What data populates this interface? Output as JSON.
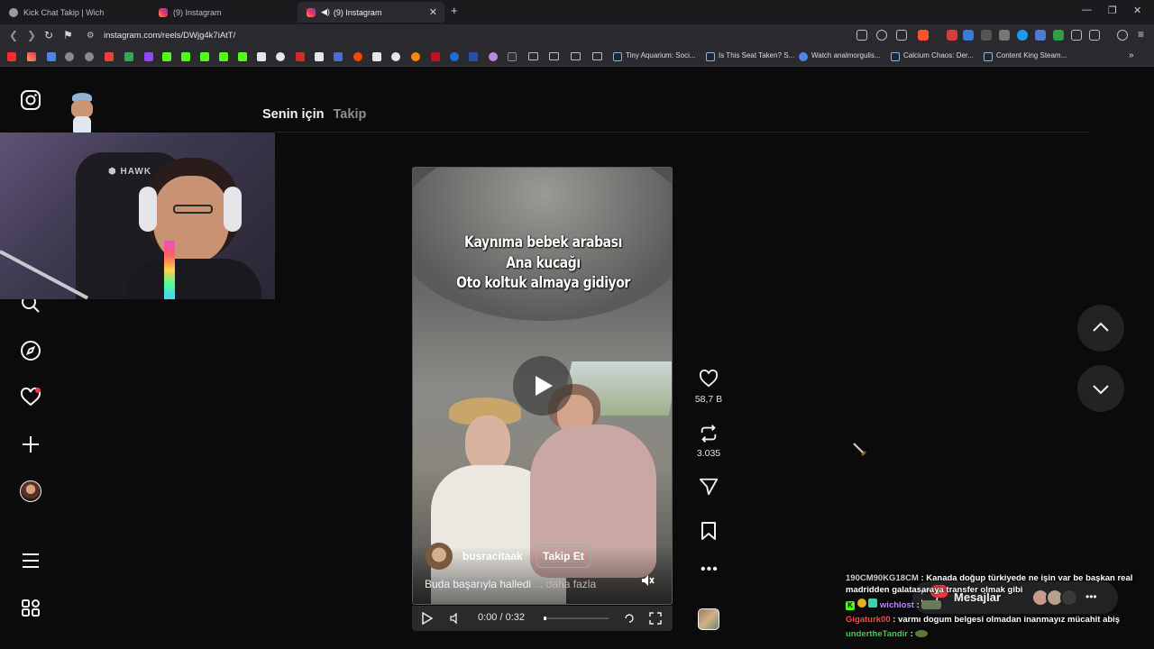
{
  "browser": {
    "tabs": [
      {
        "title": "Kick Chat Takip | Wich",
        "active": false
      },
      {
        "title": "(9) Instagram",
        "active": false
      },
      {
        "title": "(9) Instagram",
        "active": true
      }
    ],
    "url": "instagram.com/reels/DWjg4k7iAtT/",
    "bookmarks": [
      "Tiny Aquarium: Soci...",
      "Is This Seat Taken? S...",
      "Watch analmorgulis...",
      "Calcium Chaos: Der...",
      "Content King Steam..."
    ]
  },
  "instagram": {
    "feed_tabs": {
      "for_you": "Senin için",
      "following": "Takip"
    },
    "reel": {
      "overlay_lines": [
        "Kaynıma bebek arabası",
        "Ana kucağı",
        "Oto koltuk almaya gidiyor"
      ],
      "username": "busracitaak",
      "follow_label": "Takip Et",
      "caption": "Buda başarıyla halledi",
      "more_label": "... daha fazla",
      "time": "0:00 / 0:32"
    },
    "actions": {
      "likes": "58,7 B",
      "reposts": "3.035"
    },
    "messages_label": "Mesajlar",
    "messages_badge": "9+"
  },
  "chat": [
    {
      "user": "190CM90KG18CM",
      "user_color": "#cfcfcf",
      "text": ": Kanada doğup türkiyede ne işin var be başkan real",
      "cont": "madridden galatasaraya transfer olmak gibi"
    },
    {
      "badges": "K",
      "user": "wichlost",
      "user_color": "#c38bff",
      "text": ":"
    },
    {
      "user": "Gigaturk00",
      "user_color": "#ff4a4a",
      "text": ": varmı dogum belgesi olmadan inanmayız mücahit abiş"
    },
    {
      "user": "undertheTandir",
      "user_color": "#3fd05a",
      "text": ":"
    }
  ],
  "colors": {
    "accent_red": "#ff3040",
    "follow_border": "#a8a8a8",
    "kick_green": "#53fc18"
  }
}
